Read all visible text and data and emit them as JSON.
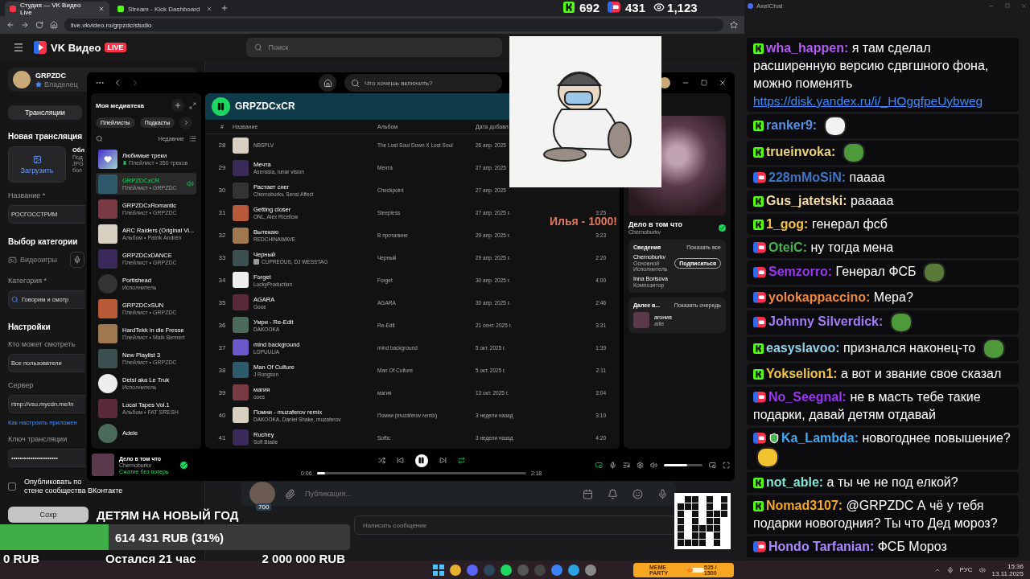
{
  "browser": {
    "tabs": [
      {
        "title": "Студия — VK Видео Live",
        "selected": true
      },
      {
        "title": "Stream - Kick Dashboard",
        "selected": false
      }
    ],
    "address": "live.vkvideo.ru/grpzdc/studio"
  },
  "vk": {
    "logo": "VK Видео",
    "live_badge": "LIVE",
    "search_placeholder": "Поиск",
    "channel": {
      "name": "GRPZDC",
      "role": "Владелец"
    },
    "tab": "Трансляции",
    "heading": "Новая трансляция",
    "upload_button": "Загрузить",
    "cover_title": "Обл",
    "cover_hint": [
      "Под",
      "JPG",
      "бол"
    ],
    "form": [
      {
        "kind": "label",
        "text": "Название *"
      },
      {
        "kind": "field",
        "value": "РОСГОССТРИМ"
      },
      {
        "kind": "heading",
        "text": "Выбор категории"
      },
      {
        "kind": "chip",
        "text": "Видеоигры"
      },
      {
        "kind": "label",
        "text": "Категория *"
      },
      {
        "kind": "search",
        "value": "Говорим и смотр"
      },
      {
        "kind": "heading",
        "text": "Настройки"
      },
      {
        "kind": "label",
        "text": "Кто может смотреть"
      },
      {
        "kind": "field",
        "value": "Все пользователи"
      },
      {
        "kind": "label",
        "text": "Сервер"
      },
      {
        "kind": "field",
        "value": "rtmp://vsu.mycdn.me/in"
      },
      {
        "kind": "link",
        "text": "Как настроить приложен"
      },
      {
        "kind": "label",
        "text": "Ключ трансляции"
      },
      {
        "kind": "field",
        "value": "••••••••••••••••••••••"
      },
      {
        "kind": "checkbox",
        "checked": false,
        "lines": [
          "Опубликовать по",
          "стене сообщества ВКонтакте"
        ]
      },
      {
        "kind": "button",
        "text": "Сохр"
      }
    ],
    "publication_placeholder": "Публикация...",
    "viewer_badge": "700",
    "message_placeholder": "Написать сообщение"
  },
  "player_app": {
    "search_placeholder": "Что хочешь включить?",
    "library": {
      "title": "Моя медиатека",
      "filters": [
        "Плейлисты",
        "Подкасты"
      ],
      "sort": "Недавние",
      "items": [
        {
          "kind": "liked",
          "title": "Любимые треки",
          "subtitle": "Плейлист • 350 треков",
          "pinned": true,
          "selected": false
        },
        {
          "kind": "playlist",
          "title": "GRPZDCxCR",
          "subtitle": "Плейлист • GRPZDC",
          "pinned": false,
          "selected": true
        },
        {
          "kind": "playlist",
          "title": "GRPZDCxRomantic",
          "subtitle": "Плейлист • GRPZDC",
          "pinned": false,
          "selected": false
        },
        {
          "kind": "album",
          "title": "ARC Raiders (Original Vi...",
          "subtitle": "Альбом • Patrik Andrén",
          "pinned": false,
          "selected": false
        },
        {
          "kind": "playlist",
          "title": "GRPZDCxDANCE",
          "subtitle": "Плейлист • GRPZDC",
          "pinned": false,
          "selected": false
        },
        {
          "kind": "artist",
          "title": "Portishead",
          "subtitle": "Исполнитель",
          "pinned": false,
          "selected": false
        },
        {
          "kind": "playlist",
          "title": "GRPZDCxSUN",
          "subtitle": "Плейлист • GRPZDC",
          "pinned": false,
          "selected": false
        },
        {
          "kind": "playlist",
          "title": "HardTekk in die Fresse",
          "subtitle": "Плейлист • Maik Bernert",
          "pinned": false,
          "selected": false
        },
        {
          "kind": "playlist",
          "title": "New Playlist 3",
          "subtitle": "Плейлист • GRPZDC",
          "pinned": false,
          "selected": false
        },
        {
          "kind": "artist",
          "title": "Detsl aka Le Truk",
          "subtitle": "Исполнитель",
          "pinned": false,
          "selected": false
        },
        {
          "kind": "album",
          "title": "Local Tapes Vol.1",
          "subtitle": "Альбом • FAT SRESH",
          "pinned": false,
          "selected": false
        },
        {
          "kind": "artist",
          "title": "Adele",
          "selected": false
        }
      ]
    },
    "playlist": {
      "title": "GRPZDCxCR",
      "playing": true,
      "columns": [
        "#",
        "Название",
        "Альбом",
        "Дата добавл"
      ],
      "tracks": [
        {
          "n": "28",
          "artist": "NBSPLV",
          "album": "The Lost Soul Down X Lost Soul",
          "added": "26 апр. 2025",
          "explicit": false
        },
        {
          "n": "29",
          "title": "Мечта",
          "artist": "Asenssia, lunar vision",
          "album": "Мечта",
          "added": "27 апр. 2025",
          "explicit": false
        },
        {
          "n": "30",
          "title": "Растает снег",
          "artist": "Chernoburkv, Sensi Affect",
          "album": "Checkpoint",
          "added": "27 апр. 2025",
          "explicit": false
        },
        {
          "n": "31",
          "title": "Getting closer",
          "artist": "ONL, Alex Ricellow",
          "album": "Sleepless",
          "added": "27 апр. 2025 г.",
          "duration": "3:25",
          "explicit": false
        },
        {
          "n": "32",
          "title": "Вытекаю",
          "artist": "REDCHINAWAVE",
          "album": "В проталине",
          "added": "29 апр. 2025 г.",
          "duration": "3:23",
          "explicit": false
        },
        {
          "n": "33",
          "title": "Черный",
          "artist": "CUPREOUS, DJ WESSTAG",
          "album": "Черный",
          "added": "29 апр. 2025 г.",
          "duration": "2:20",
          "explicit": true
        },
        {
          "n": "34",
          "title": "Forget",
          "artist": "LuckyProduction",
          "album": "Forget",
          "added": "30 апр. 2025 г.",
          "duration": "4:00",
          "explicit": false
        },
        {
          "n": "35",
          "title": "AGARA",
          "artist": "Goos",
          "album": "AGARA",
          "added": "30 апр. 2025 г.",
          "duration": "2:46",
          "explicit": false
        },
        {
          "n": "36",
          "title": "Умри - Re-Edit",
          "artist": "DAKOOKA",
          "album": "Re-Edit",
          "added": "21 сент. 2025 г.",
          "duration": "3:31",
          "explicit": false
        },
        {
          "n": "37",
          "title": "mind background",
          "artist": "LOPUULIA",
          "album": "mind background",
          "added": "5 окт. 2025 г.",
          "duration": "1:39",
          "explicit": false
        },
        {
          "n": "38",
          "title": "Man Of Culture",
          "artist": "J Rongson",
          "album": "Man Of Culture",
          "added": "5 окт. 2025 г.",
          "duration": "2:11",
          "explicit": false
        },
        {
          "n": "39",
          "title": "магия",
          "artist": "ooes",
          "album": "магия",
          "added": "13 окт. 2025 г.",
          "duration": "3:04",
          "explicit": false
        },
        {
          "n": "40",
          "title": "Помни - muzaferov remix",
          "artist": "DAKOOKA, Daniel Shake, muzaferov",
          "album": "Помни (muzaferov remix)",
          "added": "3 недели назад",
          "duration": "3:10",
          "explicit": false
        },
        {
          "n": "41",
          "title": "Ruchey",
          "artist": "Soft Blade",
          "album": "Softic",
          "added": "3 недели назад",
          "duration": "4:20",
          "explicit": false
        }
      ]
    },
    "now_playing": {
      "title": "Дело в том что",
      "artist": "Chernoburkv",
      "liked": true,
      "credits_title": "Сведения",
      "credits_link": "Показать все",
      "credits": [
        {
          "name": "Chernoburkv",
          "role": "Основной Исполнитель",
          "action": "Подписаться"
        },
        {
          "name": "Inna Borisova",
          "role": "Композитор"
        }
      ],
      "queue_title": "Далее в...",
      "queue_link": "Показать очередь",
      "queue": [
        {
          "title": "агония",
          "artist": "ailie"
        }
      ]
    },
    "player": {
      "title": "Дело в том что",
      "artist": "Chernoburkv",
      "quality": "Сжатие без потерь",
      "liked": true,
      "playing": true,
      "elapsed": "0:06",
      "total": "2:18",
      "progress": {
        "level": 0.04
      },
      "volume": {
        "level": 0.6
      }
    }
  },
  "donation_alert": "Илья  - 1000!",
  "viewer_counts": [
    {
      "kind": "kick",
      "count": "692"
    },
    {
      "kind": "vk",
      "count": "431"
    },
    {
      "kind": "total",
      "count": "1,123"
    }
  ],
  "chat": {
    "title": "AxelChat",
    "messages": [
      {
        "kind": "kick",
        "user": "wha_happen:",
        "color": "#b25cf0",
        "moderator": false,
        "parts": [
          {
            "kind": "text",
            "text": "я там сделал расширенную версию сдвгшного фона, можно поменять"
          },
          {
            "kind": "link",
            "text": "https://disk.yandex.ru/i/_HOgqfpeUybweg"
          }
        ]
      },
      {
        "kind": "kick",
        "user": "ranker9:",
        "color": "#5a8fe0",
        "moderator": false,
        "parts": [
          {
            "kind": "emote",
            "color": "#f2f2f2"
          }
        ]
      },
      {
        "kind": "kick",
        "user": "trueinvoka:",
        "color": "#ecd27a",
        "moderator": false,
        "parts": [
          {
            "kind": "emote",
            "color": "#4e9a3a"
          }
        ]
      },
      {
        "kind": "vk",
        "user": "228mMoSiN:",
        "color": "#3f74c2",
        "moderator": false,
        "parts": [
          {
            "kind": "text",
            "text": "паааа"
          }
        ]
      },
      {
        "kind": "kick",
        "user": "Gus_jatetski:",
        "color": "#f3dca6",
        "moderator": false,
        "parts": [
          {
            "kind": "text",
            "text": "рааааа"
          }
        ]
      },
      {
        "kind": "kick",
        "user": "1_gog:",
        "color": "#f4c542",
        "moderator": false,
        "parts": [
          {
            "kind": "text",
            "text": "генерал фсб"
          }
        ]
      },
      {
        "kind": "vk",
        "user": "OteiC:",
        "color": "#4caf50",
        "moderator": false,
        "parts": [
          {
            "kind": "text",
            "text": "ну тогда мена"
          }
        ]
      },
      {
        "kind": "vk",
        "user": "Semzorro:",
        "color": "#9b35f5",
        "moderator": false,
        "parts": [
          {
            "kind": "text",
            "text": "Генерал ФСБ"
          },
          {
            "kind": "emote",
            "color": "#5a7a3a"
          }
        ]
      },
      {
        "kind": "vk",
        "user": "yolokappaccino:",
        "color": "#f08a3c",
        "moderator": false,
        "parts": [
          {
            "kind": "text",
            "text": "Мера?"
          }
        ]
      },
      {
        "kind": "vk",
        "user": "Johnny Silverdick:",
        "color": "#a07cf5",
        "moderator": false,
        "parts": [
          {
            "kind": "emote",
            "color": "#4e9a3a"
          }
        ]
      },
      {
        "kind": "kick",
        "user": "easyslavoo:",
        "color": "#8fd3ea",
        "moderator": false,
        "parts": [
          {
            "kind": "text",
            "text": "признался наконец-то"
          },
          {
            "kind": "emote",
            "color": "#4e9a3a"
          }
        ]
      },
      {
        "kind": "kick",
        "user": "Yokselion1:",
        "color": "#f4c542",
        "moderator": false,
        "parts": [
          {
            "kind": "text",
            "text": "а вот и звание свое сказал"
          }
        ]
      },
      {
        "kind": "vk",
        "user": "No_Seegnal:",
        "color": "#9b35f5",
        "moderator": false,
        "parts": [
          {
            "kind": "text",
            "text": "не в масть тебе такие подарки, давай детям отдавай"
          }
        ]
      },
      {
        "kind": "vk",
        "user": "Ka_Lambda:",
        "color": "#3fa9f5",
        "moderator": true,
        "parts": [
          {
            "kind": "text",
            "text": "новогоднее повышение?"
          },
          {
            "kind": "emote",
            "color": "#f2c230"
          }
        ]
      },
      {
        "kind": "kick",
        "user": "not_able:",
        "color": "#84e3d2",
        "moderator": false,
        "parts": [
          {
            "kind": "text",
            "text": "а ты че не под елкой?"
          }
        ]
      },
      {
        "kind": "kick",
        "user": "Nomad3107:",
        "color": "#f5a623",
        "moderator": false,
        "parts": [
          {
            "kind": "text",
            "text": "@GRPZDC А чё у тебя подарки новогодния? Ты что Дед мороз?"
          }
        ]
      },
      {
        "kind": "vk",
        "user": "Hondo Tarfanian:",
        "color": "#a98bff",
        "moderator": false,
        "parts": [
          {
            "kind": "text",
            "text": "ФСБ Мороз"
          }
        ]
      }
    ]
  },
  "goal": {
    "title": "ДЕТЯМ НА НОВЫЙ ГОД",
    "amount": "614 431 RUB (31%)",
    "level": 0.31,
    "start": "0 RUB",
    "remaining": "Остался 21 час",
    "target": "2 000 000 RUB"
  },
  "meme_widget": {
    "title": "MEME PARTY",
    "progress": "525 / 1500",
    "level": 0.35
  },
  "taskbar": {
    "language": "РУС",
    "time": "15:36",
    "date": "13.11.2025"
  }
}
